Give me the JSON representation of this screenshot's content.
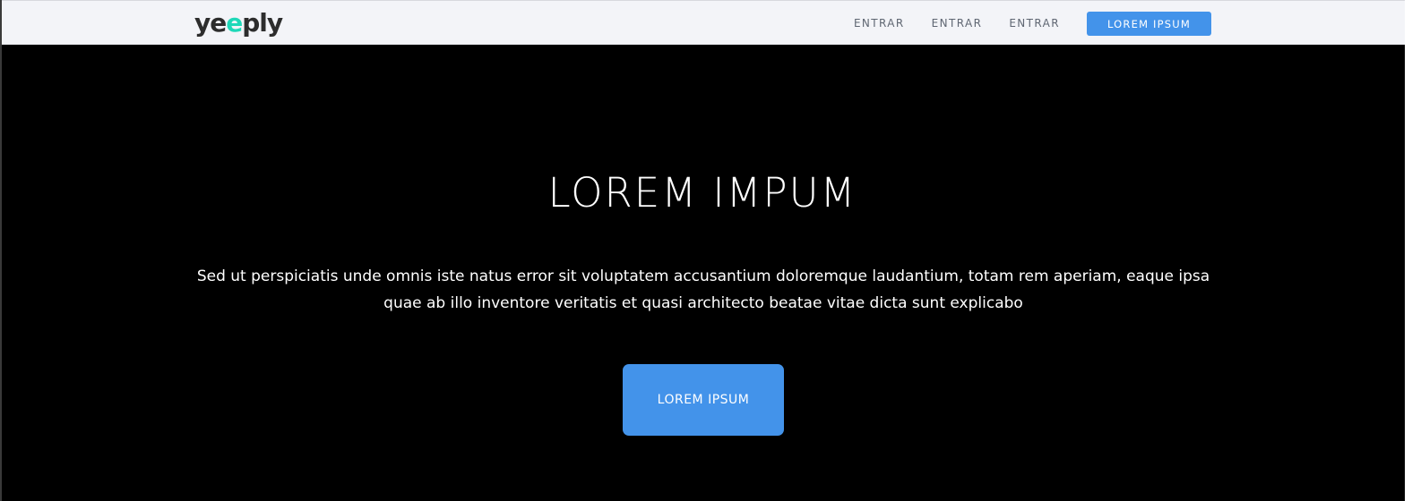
{
  "header": {
    "logo": {
      "prefix": "ye",
      "accent": "e",
      "suffix": "ply"
    },
    "nav_links": [
      "ENTRAR",
      "ENTRAR",
      "ENTRAR"
    ],
    "cta_label": "LOREM IPSUM"
  },
  "hero": {
    "title": "LOREM IMPUM",
    "text": "Sed ut perspiciatis unde omnis iste natus error sit voluptatem accusantium doloremque laudantium, totam rem aperiam, eaque ipsa quae ab illo inventore veritatis et quasi architecto beatae vitae dicta sunt explicabo",
    "button_label": "LOREM IPSUM"
  },
  "colors": {
    "accent_blue": "#4393ea",
    "logo_accent": "#1fd8b8",
    "navbar_bg": "#f3f4f8",
    "hero_bg": "#000000"
  }
}
